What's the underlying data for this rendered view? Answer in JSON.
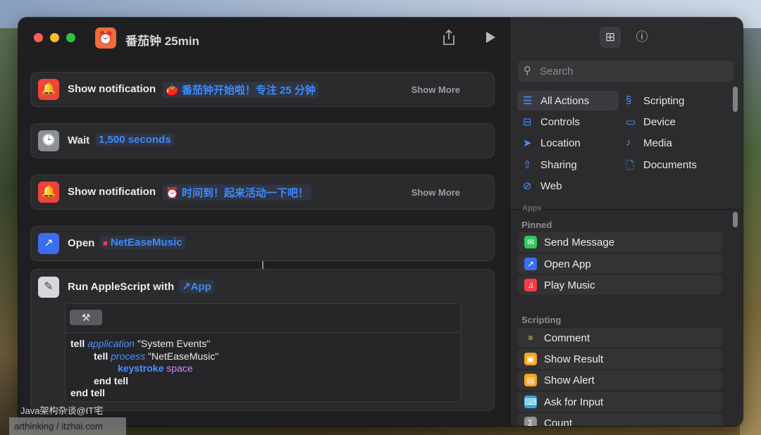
{
  "window": {
    "title": "番茄钟 25min",
    "app_icon": "alarm-clock-icon"
  },
  "actions": [
    {
      "kind": "notification",
      "label": "Show notification",
      "token": "番茄钟开始啦！专注 25 分钟",
      "token_emoji": "🍅",
      "more": "Show More",
      "icon": "bell-icon"
    },
    {
      "kind": "wait",
      "label": "Wait",
      "token": "1,500 seconds",
      "icon": "clock-icon"
    },
    {
      "kind": "notification",
      "label": "Show notification",
      "token": "时间到！起来活动一下吧！",
      "token_emoji": "⏰",
      "more": "Show More",
      "icon": "bell-icon"
    },
    {
      "kind": "open",
      "label": "Open",
      "token": "NetEaseMusic",
      "icon": "arrow-up-right-icon"
    },
    {
      "kind": "applescript",
      "label": "Run AppleScript with",
      "token": "App",
      "icon": "script-icon"
    }
  ],
  "script": {
    "line1": {
      "kw": "tell",
      "cls": "application",
      "str": "\"System Events\""
    },
    "line2": {
      "kw": "tell",
      "cls": "process",
      "str": "\"NetEaseMusic\""
    },
    "line3": {
      "cmd": "keystroke",
      "con": "space"
    },
    "line4": "end tell",
    "line5": "end tell"
  },
  "sidebar": {
    "search_placeholder": "Search",
    "categories_left": [
      {
        "label": "All Actions",
        "icon": "list-icon",
        "selected": true
      },
      {
        "label": "Controls",
        "icon": "toggles-icon"
      },
      {
        "label": "Location",
        "icon": "location-arrow-icon"
      },
      {
        "label": "Sharing",
        "icon": "share-icon"
      },
      {
        "label": "Web",
        "icon": "compass-icon"
      }
    ],
    "categories_right": [
      {
        "label": "Scripting",
        "icon": "scripting-icon"
      },
      {
        "label": "Device",
        "icon": "display-icon"
      },
      {
        "label": "Media",
        "icon": "music-note-icon"
      },
      {
        "label": "Documents",
        "icon": "document-icon"
      }
    ],
    "cut_section": "Apps",
    "pinned_title": "Pinned",
    "pinned": [
      {
        "label": "Send Message",
        "icon": "message-icon",
        "color": "#34c759"
      },
      {
        "label": "Open App",
        "icon": "arrow-up-right-icon",
        "color": "#3a6df0"
      },
      {
        "label": "Play Music",
        "icon": "music-icon",
        "color": "#fc3c44"
      }
    ],
    "scripting_title": "Scripting",
    "scripting": [
      {
        "label": "Comment",
        "icon": "comment-lines-icon",
        "color": "#333336"
      },
      {
        "label": "Show Result",
        "icon": "result-icon",
        "color": "#f5a623"
      },
      {
        "label": "Show Alert",
        "icon": "alert-icon",
        "color": "#f5a623"
      },
      {
        "label": "Ask for Input",
        "icon": "input-icon",
        "color": "#34aadc"
      },
      {
        "label": "Count",
        "icon": "count-icon",
        "color": "#8e8e93"
      }
    ]
  },
  "watermark": {
    "line1": "Java架构杂谈@IT宅",
    "line2": "arthinking / itzhai.com"
  }
}
